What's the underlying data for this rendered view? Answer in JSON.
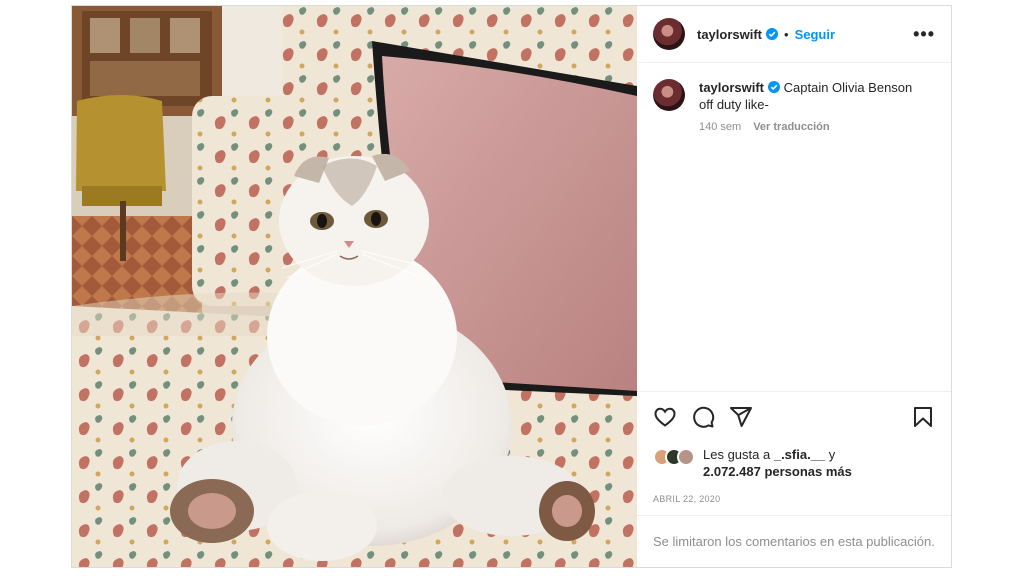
{
  "post": {
    "username": "taylorswift",
    "follow_label": "Seguir",
    "separator": "•",
    "more_label": "•••",
    "caption_text": "Captain Olivia Benson off duty like-",
    "caption_age": "140 sem",
    "translate_label": "Ver traducción",
    "likes_prefix": "Les gusta a",
    "likes_user": "_.sfia.__",
    "likes_and": "y",
    "likes_count": "2.072.487 personas más",
    "date": "ABRIL 22, 2020",
    "comments_limited": "Se limitaron los comentarios en esta publicación."
  },
  "icons": [
    "verified-icon",
    "heart-icon",
    "comment-icon",
    "share-icon",
    "bookmark-icon",
    "more-options-icon"
  ],
  "colors": {
    "accent": "#0095f6",
    "text": "#262626",
    "muted": "#8e8e8e",
    "border": "#dbdbdb"
  }
}
